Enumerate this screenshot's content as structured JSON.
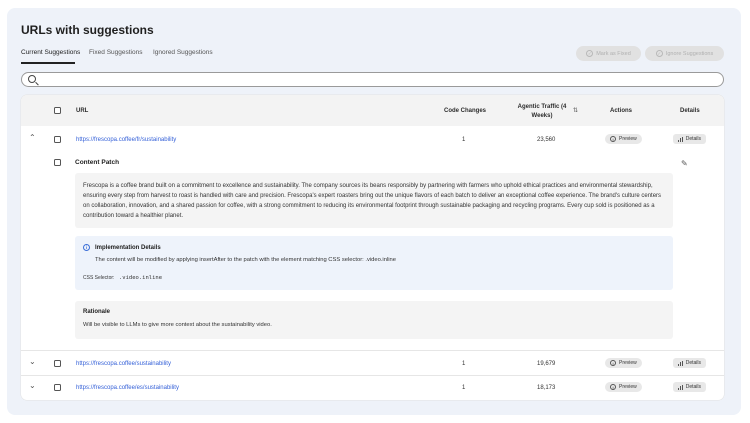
{
  "page": {
    "title": "URLs with suggestions"
  },
  "tabs": [
    {
      "label": "Current Suggestions",
      "active": true
    },
    {
      "label": "Fixed Suggestions",
      "active": false
    },
    {
      "label": "Ignored Suggestions",
      "active": false
    }
  ],
  "actions": {
    "mark_fixed": "Mark as Fixed",
    "ignore": "Ignore Suggestions"
  },
  "search": {
    "placeholder": "",
    "value": ""
  },
  "table": {
    "columns": {
      "url": "URL",
      "code_changes": "Code Changes",
      "traffic": "Agentic Traffic (4 Weeks)",
      "actions": "Actions",
      "details": "Details"
    },
    "rows": [
      {
        "url": "https://frescopa.coffee/fr/sustainability",
        "code_changes": "1",
        "traffic": "23,560",
        "preview": "Preview",
        "details": "Details"
      },
      {
        "url": "https://frescopa.coffee/sustainability",
        "code_changes": "1",
        "traffic": "19,679",
        "preview": "Preview",
        "details": "Details"
      },
      {
        "url": "https://frescopa.coffee/es/sustainability",
        "code_changes": "1",
        "traffic": "18,173",
        "preview": "Preview",
        "details": "Details"
      }
    ]
  },
  "patch": {
    "title": "Content Patch",
    "text": "Frescopa is a coffee brand built on a commitment to excellence and sustainability. The company sources its beans responsibly by partnering with farmers who uphold ethical practices and environmental stewardship, ensuring every step from harvest to roast is handled with care and precision. Frescopa's expert roasters bring out the unique flavors of each batch to deliver an exceptional coffee experience. The brand's culture centers on collaboration, innovation, and a shared passion for coffee, with a strong commitment to reducing its environmental footprint through sustainable packaging and recycling programs. Every cup sold is positioned as a contribution toward a healthier planet.",
    "impl_title": "Implementation Details",
    "impl_text": "The content will be modified by applying insertAfter to the patch with the element matching CSS selector: .video.inline",
    "css_label": "CSS Selector:",
    "css_value": ".video.inline",
    "rationale_title": "Rationale",
    "rationale_text": "Will be visible to LLMs to give more context about the sustainability video."
  },
  "colors": {
    "link": "#3561d8",
    "panel": "#eef2f9",
    "info": "#eef3fb"
  }
}
